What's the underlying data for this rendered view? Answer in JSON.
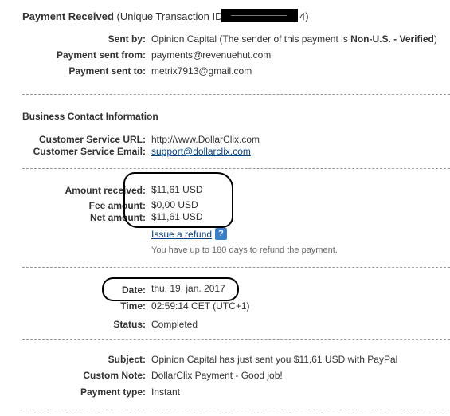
{
  "header": {
    "title": "Payment Received",
    "unique_prefix": "(Unique Transaction ID # 2",
    "unique_suffix": "4)"
  },
  "sender": {
    "sent_by_label": "Sent by:",
    "sent_by_name": "Opinion Capital",
    "sent_by_note_open": "(The sender of this payment is ",
    "sent_by_status": "Non-U.S. - Verified",
    "sent_by_note_close": ")",
    "sent_from_label": "Payment sent from:",
    "sent_from_value": "payments@revenuehut.com",
    "sent_to_label": "Payment sent to:",
    "sent_to_value": "metrix7913@gmail.com"
  },
  "business": {
    "heading": "Business Contact Information",
    "url_label": "Customer Service URL:",
    "url_value": "http://www.DollarClix.com",
    "email_label": "Customer Service Email:",
    "email_value": "support@dollarclix.com"
  },
  "amounts": {
    "received_label": "Amount received:",
    "received_value": "$11,61 USD",
    "fee_label": "Fee amount:",
    "fee_value": "$0,00 USD",
    "net_label": "Net amount:",
    "net_value": "$11,61 USD",
    "refund_link": "Issue a refund",
    "refund_note": "You have up to 180 days to refund the payment.",
    "help_icon": "question-mark-icon"
  },
  "timing": {
    "date_label": "Date:",
    "date_value": "thu. 19. jan. 2017",
    "time_label": "Time:",
    "time_value": "02:59:14 CET (UTC+1)",
    "status_label": "Status:",
    "status_value": "Completed"
  },
  "details": {
    "subject_label": "Subject:",
    "subject_value": "Opinion Capital has just sent you $11,61 USD with PayPal",
    "note_label": "Custom Note:",
    "note_value": "DollarClix Payment - Good job!",
    "type_label": "Payment type:",
    "type_value": "Instant"
  },
  "colors": {
    "link": "#084482",
    "separator": "#999999",
    "help_icon": "#3a7fc8"
  }
}
